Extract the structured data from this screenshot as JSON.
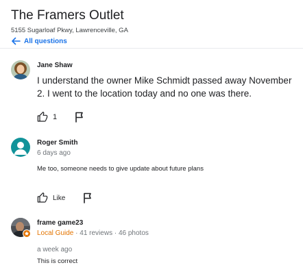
{
  "place": {
    "title": "The Framers Outlet",
    "address": "5155 Sugarloaf Pkwy, Lawrenceville, GA",
    "back_label": "All questions"
  },
  "posts": [
    {
      "author": "Jane Shaw",
      "text": "I understand the owner Mike Schmidt passed away November 2. I went to the location today and no one was there.",
      "likes": "1"
    },
    {
      "author": "Roger Smith",
      "time": "6 days ago",
      "text": "Me too, someone needs to give update about future plans",
      "like_label": "Like"
    },
    {
      "author": "frame game23",
      "badge": "Local Guide",
      "reviews": "· 41 reviews",
      "photos": "· 46 photos",
      "time": "a week ago",
      "text": "This is correct"
    }
  ],
  "colors": {
    "link": "#1a73e8",
    "local_guide": "#e37400",
    "avatar_teal": "#12939a",
    "divider": "#e8eaed"
  },
  "icons": [
    "arrow-back-icon",
    "thumb-up-icon",
    "flag-icon",
    "local-guide-star-icon"
  ]
}
